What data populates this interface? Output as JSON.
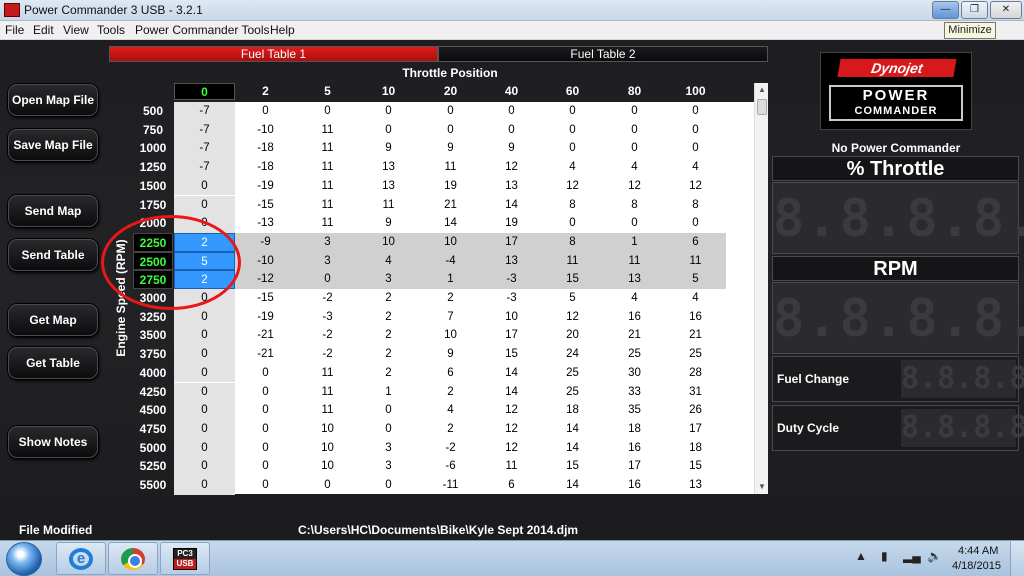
{
  "window": {
    "title": "Power Commander 3 USB - 3.2.1",
    "tooltip": "Minimize"
  },
  "menu": [
    "File",
    "Edit",
    "View",
    "Tools",
    "Power Commander Tools",
    "Help"
  ],
  "tabs": [
    {
      "label": "Fuel Table 1",
      "active": true
    },
    {
      "label": "Fuel Table 2",
      "active": false
    }
  ],
  "side_buttons": [
    "Open Map File",
    "Save Map File",
    "Send Map",
    "Send Table",
    "Get Map",
    "Get Table",
    "Show Notes"
  ],
  "grid": {
    "title": "Throttle Position",
    "y_label": "Engine Speed (RPM)",
    "columns": [
      "0",
      "2",
      "5",
      "10",
      "20",
      "40",
      "60",
      "80",
      "100"
    ],
    "rows": [
      {
        "rpm": "500",
        "values": [
          "-7",
          "0",
          "0",
          "0",
          "0",
          "0",
          "0",
          "0",
          "0"
        ]
      },
      {
        "rpm": "750",
        "values": [
          "-7",
          "-10",
          "11",
          "0",
          "0",
          "0",
          "0",
          "0",
          "0"
        ]
      },
      {
        "rpm": "1000",
        "values": [
          "-7",
          "-18",
          "11",
          "9",
          "9",
          "9",
          "0",
          "0",
          "0"
        ]
      },
      {
        "rpm": "1250",
        "values": [
          "-7",
          "-18",
          "11",
          "13",
          "11",
          "12",
          "4",
          "4",
          "4"
        ]
      },
      {
        "rpm": "1500",
        "values": [
          "0",
          "-19",
          "11",
          "13",
          "19",
          "13",
          "12",
          "12",
          "12"
        ]
      },
      {
        "rpm": "1750",
        "values": [
          "0",
          "-15",
          "11",
          "11",
          "21",
          "14",
          "8",
          "8",
          "8"
        ]
      },
      {
        "rpm": "2000",
        "values": [
          "0",
          "-13",
          "11",
          "9",
          "14",
          "19",
          "0",
          "0",
          "0"
        ]
      },
      {
        "rpm": "2250",
        "values": [
          "2",
          "-9",
          "3",
          "10",
          "10",
          "17",
          "8",
          "1",
          "6"
        ],
        "selected": true
      },
      {
        "rpm": "2500",
        "values": [
          "5",
          "-10",
          "3",
          "4",
          "-4",
          "13",
          "11",
          "11",
          "11"
        ],
        "selected": true
      },
      {
        "rpm": "2750",
        "values": [
          "2",
          "-12",
          "0",
          "3",
          "1",
          "-3",
          "15",
          "13",
          "5"
        ],
        "selected": true
      },
      {
        "rpm": "3000",
        "values": [
          "0",
          "-15",
          "-2",
          "2",
          "2",
          "-3",
          "5",
          "4",
          "4"
        ]
      },
      {
        "rpm": "3250",
        "values": [
          "0",
          "-19",
          "-3",
          "2",
          "7",
          "10",
          "12",
          "16",
          "16"
        ]
      },
      {
        "rpm": "3500",
        "values": [
          "0",
          "-21",
          "-2",
          "2",
          "10",
          "17",
          "20",
          "21",
          "21"
        ]
      },
      {
        "rpm": "3750",
        "values": [
          "0",
          "-21",
          "-2",
          "2",
          "9",
          "15",
          "24",
          "25",
          "25"
        ]
      },
      {
        "rpm": "4000",
        "values": [
          "0",
          "0",
          "11",
          "2",
          "6",
          "14",
          "25",
          "30",
          "28"
        ]
      },
      {
        "rpm": "4250",
        "values": [
          "0",
          "0",
          "11",
          "1",
          "2",
          "14",
          "25",
          "33",
          "31"
        ]
      },
      {
        "rpm": "4500",
        "values": [
          "0",
          "0",
          "11",
          "0",
          "4",
          "12",
          "18",
          "35",
          "26"
        ]
      },
      {
        "rpm": "4750",
        "values": [
          "0",
          "0",
          "10",
          "0",
          "2",
          "12",
          "14",
          "18",
          "17"
        ]
      },
      {
        "rpm": "5000",
        "values": [
          "0",
          "0",
          "10",
          "3",
          "-2",
          "12",
          "14",
          "16",
          "18"
        ]
      },
      {
        "rpm": "5250",
        "values": [
          "0",
          "0",
          "10",
          "3",
          "-6",
          "11",
          "15",
          "17",
          "15"
        ]
      },
      {
        "rpm": "5500",
        "values": [
          "0",
          "0",
          "0",
          "0",
          "-11",
          "6",
          "14",
          "16",
          "13"
        ]
      }
    ]
  },
  "right_panel": {
    "logo_top": "Dynojet",
    "logo_line1": "POWER",
    "logo_line2": "COMMANDER",
    "status": "No Power Commander",
    "throttle_title": "% Throttle",
    "rpm_title": "RPM",
    "display_placeholder": "8.8.8.8.8.",
    "small_placeholder": "8.8.8.8.8.",
    "fuel_change": "Fuel Change",
    "duty_cycle": "Duty Cycle"
  },
  "status_bar": {
    "modified": "File Modified",
    "path": "C:\\Users\\HC\\Documents\\Bike\\Kyle Sept 2014.djm"
  },
  "taskbar": {
    "time": "4:44 AM",
    "date": "4/18/2015",
    "pc_icon_top": "PC3",
    "pc_icon_bottom": "USB"
  },
  "colors": {
    "accent_red": "#d7181c",
    "selection_blue": "#3399ff",
    "rpm_highlight": "#3cff3c"
  }
}
